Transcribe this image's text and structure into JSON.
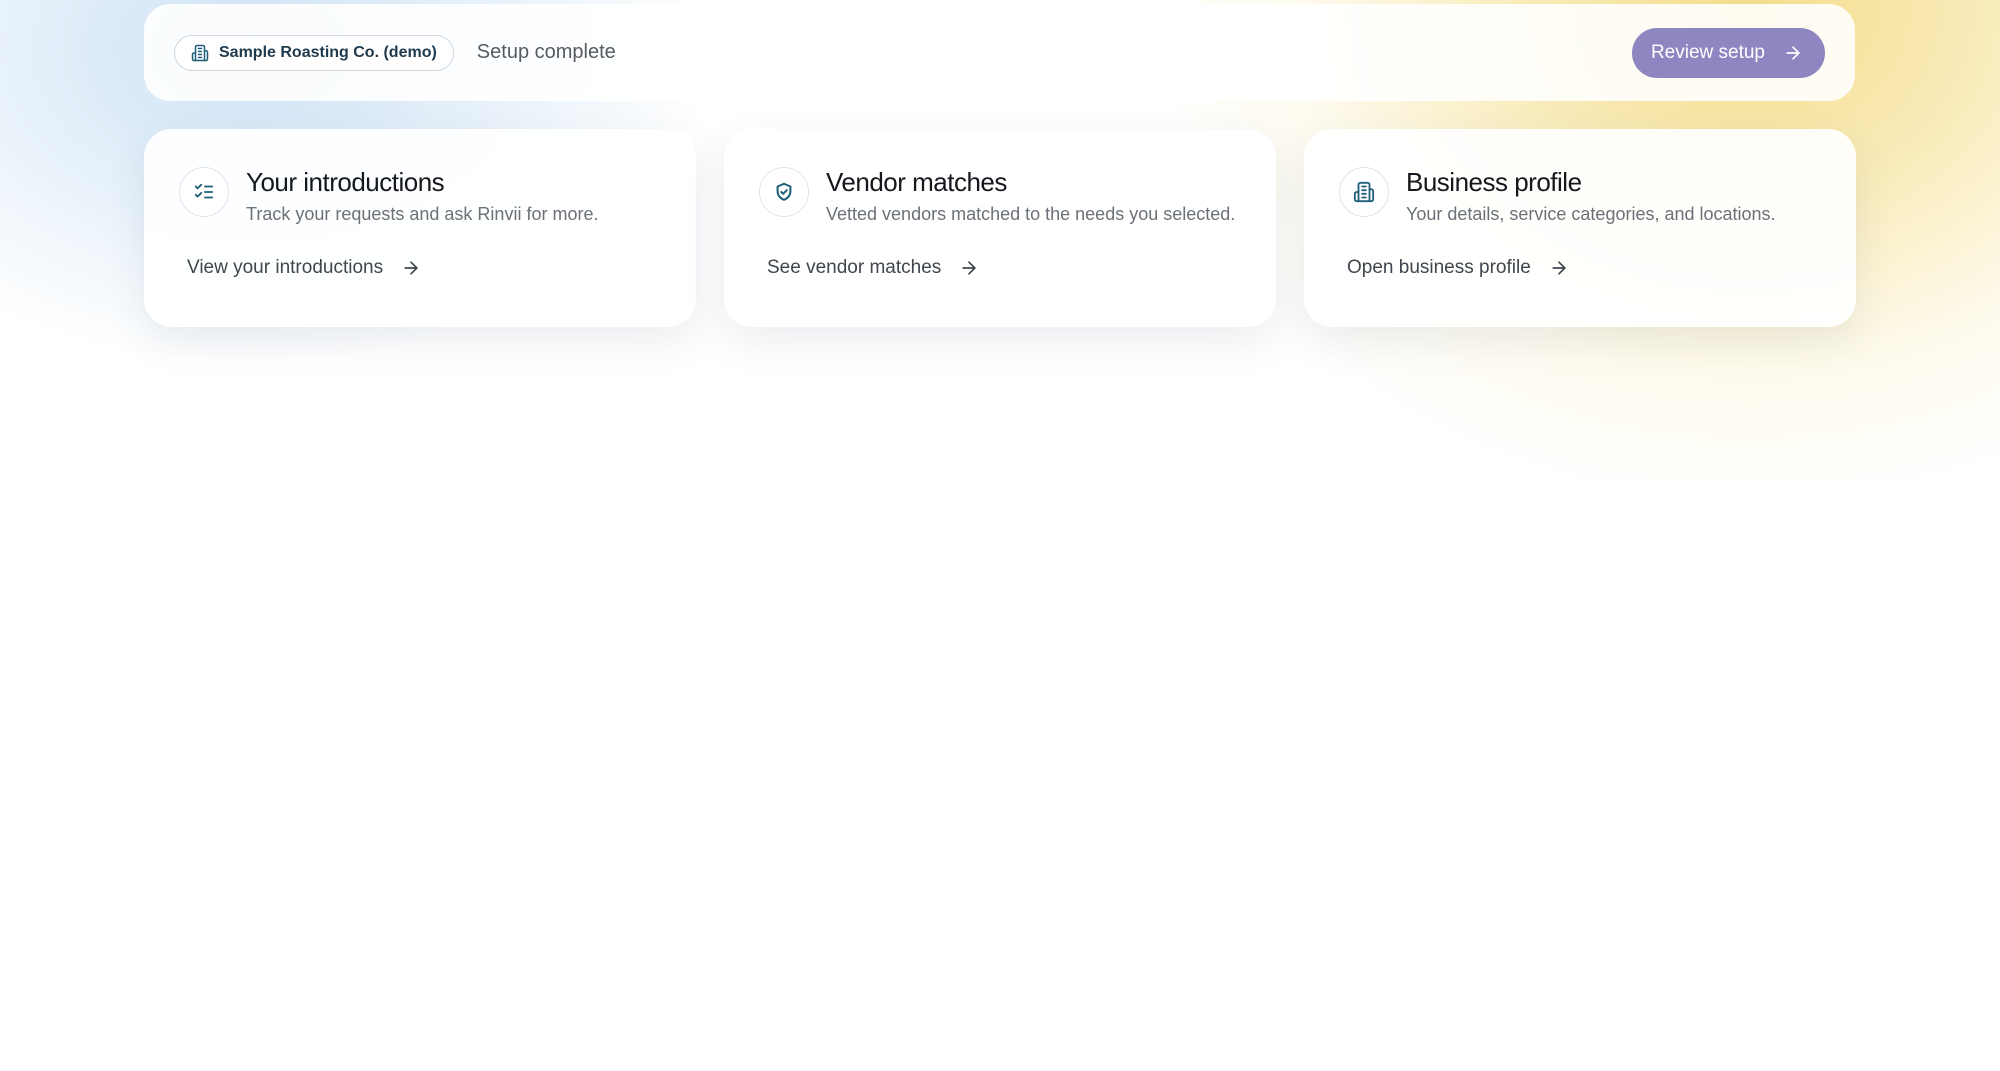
{
  "header": {
    "company_name": "Sample Roasting Co. (demo)",
    "company_icon": "building-icon",
    "status": "Setup complete",
    "review_button_label": "Review setup",
    "review_button_icon": "arrow-right-icon"
  },
  "cards": [
    {
      "icon": "checklist-icon",
      "title": "Your introductions",
      "description": "Track your requests and ask Rinvii for more.",
      "link_label": "View your introductions"
    },
    {
      "icon": "shield-check-icon",
      "title": "Vendor matches",
      "description": "Vetted vendors matched to the needs you selected.",
      "link_label": "See vendor matches"
    },
    {
      "icon": "building-icon",
      "title": "Business profile",
      "description": "Your details, service categories, and locations.",
      "link_label": "Open business profile"
    }
  ],
  "colors": {
    "accent_button": "#8e86c0",
    "icon_teal": "#1f5f7a",
    "title_text": "#14181d",
    "muted_text": "#6b7178"
  }
}
